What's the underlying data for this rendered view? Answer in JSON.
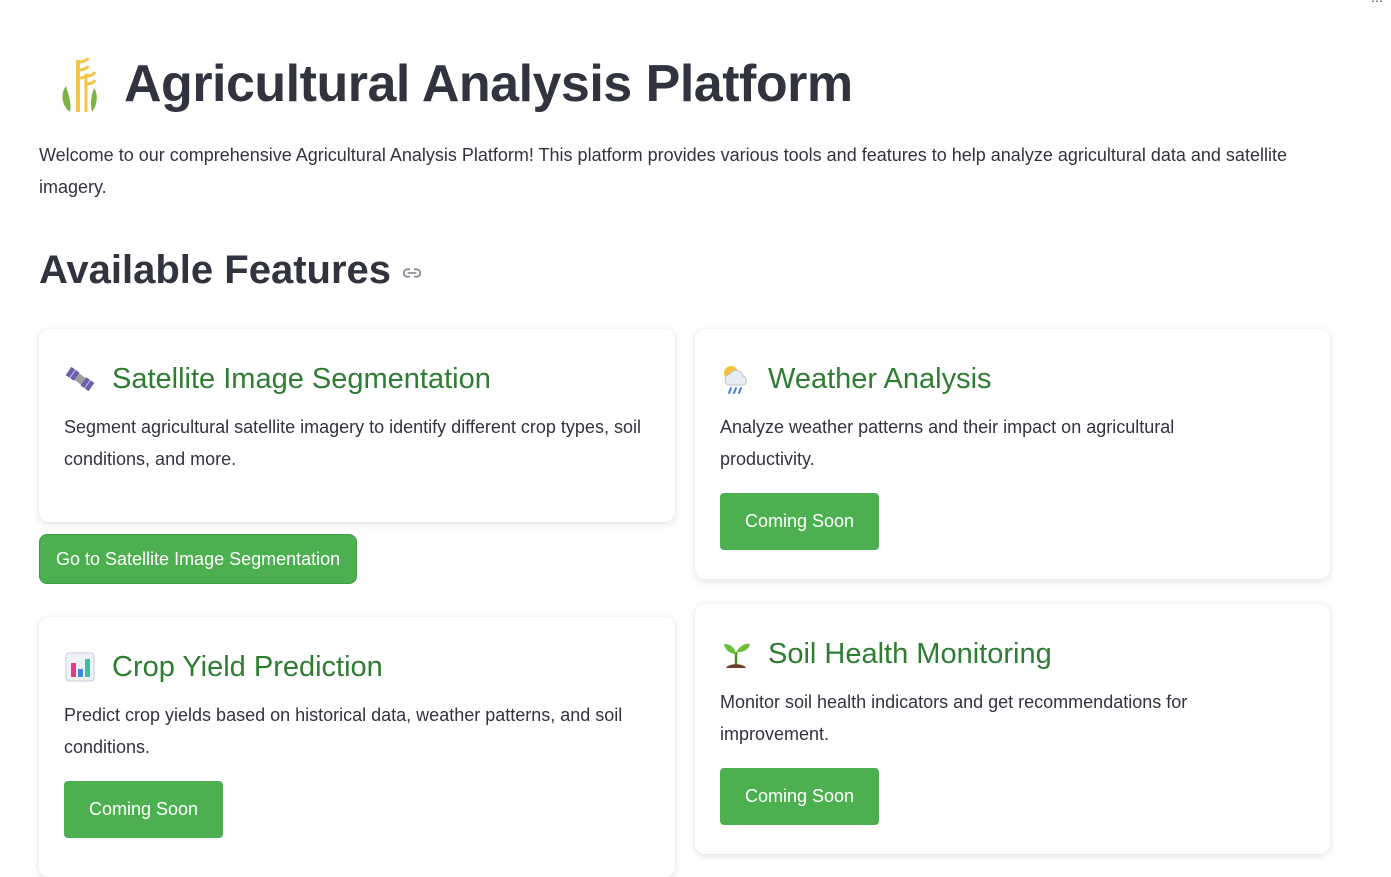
{
  "header": {
    "title": "Agricultural Analysis Platform",
    "intro": "Welcome to our comprehensive Agricultural Analysis Platform! This platform provides various tools and features to help analyze agricultural data and satellite imagery.",
    "icon": "wheat-icon"
  },
  "features_section": {
    "title": "Available Features",
    "anchor_icon": "link-icon"
  },
  "cards": [
    {
      "title": "Satellite Image Segmentation",
      "description": "Segment agricultural satellite imagery to identify different crop types, soil conditions, and more.",
      "icon": "satellite-icon",
      "button_label": "Go to Satellite Image Segmentation"
    },
    {
      "title": "Weather Analysis",
      "description": "Analyze weather patterns and their impact on agricultural productivity.",
      "icon": "rain-cloud-icon",
      "button_label": "Coming Soon"
    },
    {
      "title": "Crop Yield Prediction",
      "description": "Predict crop yields based on historical data, weather patterns, and soil conditions.",
      "icon": "bar-chart-icon",
      "button_label": "Coming Soon"
    },
    {
      "title": "Soil Health Monitoring",
      "description": "Monitor soil health indicators and get recommendations for improvement.",
      "icon": "seedling-icon",
      "button_label": "Coming Soon"
    }
  ],
  "colors": {
    "accent_green": "#4caf50",
    "title_green": "#2e7d32",
    "text": "#31333f"
  }
}
